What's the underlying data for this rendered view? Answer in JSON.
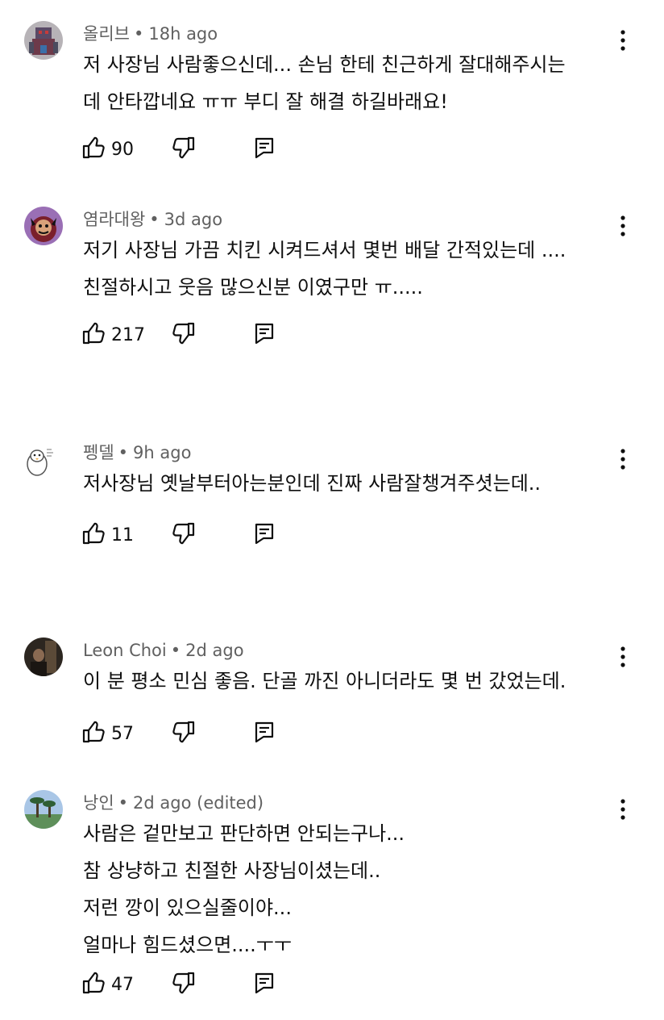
{
  "ui": {
    "separator": "•"
  },
  "comments": [
    {
      "author": "올리브",
      "time": "18h ago",
      "lines": [
        "저 사장님 사람좋으신데... 손님 한테 친근하게 잘대해주시는",
        "데 안타깝네요 ㅠㅠ 부디 잘 해결 하길바래요!"
      ],
      "likes": "90",
      "avatar_icon": "robot-avatar-icon"
    },
    {
      "author": "염라대왕",
      "time": "3d ago",
      "lines": [
        "저기 사장님 가끔 치킨 시켜드셔서 몇번 배달 간적있는데 ....",
        "친절하시고 웃음 많으신분 이였구만 ㅠ....."
      ],
      "likes": "217",
      "avatar_icon": "demon-avatar-icon"
    },
    {
      "author": "펭델",
      "time": "9h ago",
      "lines": [
        "저사장님 옛날부터아는분인데 진짜 사람잘챙겨주셧는데.."
      ],
      "likes": "11",
      "avatar_icon": "penguin-avatar-icon"
    },
    {
      "author": "Leon Choi",
      "time": "2d ago",
      "lines": [
        "이 분 평소 민심 좋음.  단골 까진 아니더라도 몇 번 갔었는데."
      ],
      "likes": "57",
      "avatar_icon": "dark-photo-avatar-icon"
    },
    {
      "author": "낭인",
      "time": "2d ago (edited)",
      "lines": [
        "사람은 겉만보고 판단하면 안되는구나...",
        "참 상냥하고 친절한 사장님이셨는데..",
        "저런 깡이 있으실줄이야...",
        "얼마나 힘드셨으면....ㅜㅜ"
      ],
      "likes": "47",
      "avatar_icon": "palm-tree-avatar-icon"
    }
  ]
}
